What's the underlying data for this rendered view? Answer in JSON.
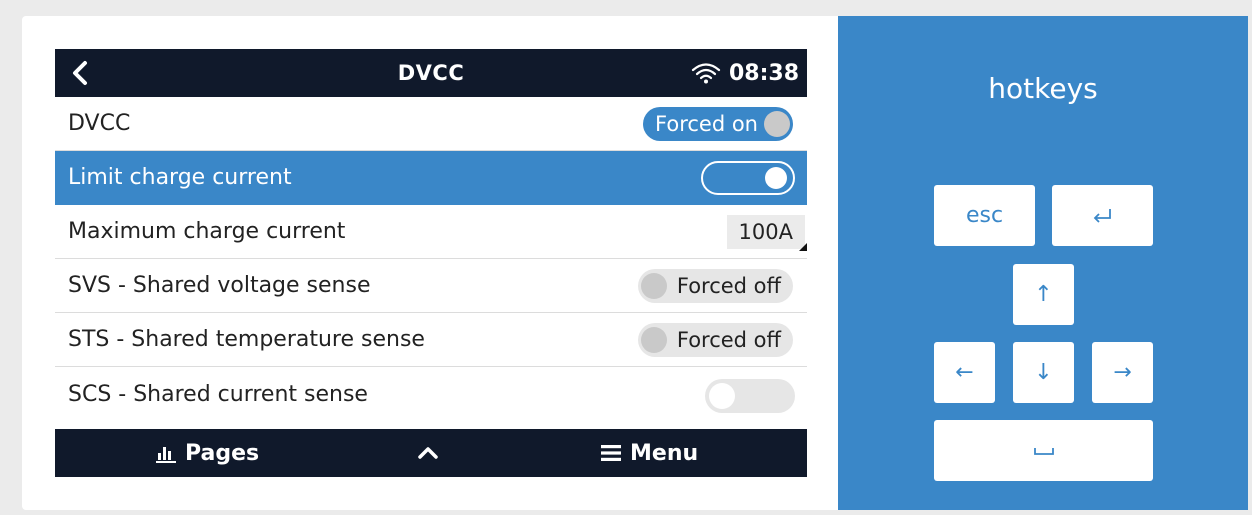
{
  "screen": {
    "title": "DVCC",
    "time": "08:38",
    "icons": {
      "back": "chevron-left-icon",
      "wifi": "wifi-icon"
    }
  },
  "settings": [
    {
      "label": "DVCC",
      "control": "pill-on",
      "value": "Forced on"
    },
    {
      "label": "Limit charge current",
      "control": "toggle",
      "state": "on",
      "selected": true
    },
    {
      "label": "Maximum charge current",
      "control": "value",
      "value": "100A"
    },
    {
      "label": "SVS - Shared voltage sense",
      "control": "pill-off",
      "value": "Forced off"
    },
    {
      "label": "STS - Shared temperature sense",
      "control": "pill-off",
      "value": "Forced off"
    },
    {
      "label": "SCS - Shared current sense",
      "control": "toggle",
      "state": "off"
    }
  ],
  "bottom_bar": {
    "pages_label": "Pages",
    "menu_label": "Menu",
    "icons": {
      "pages": "bar-chart-icon",
      "up": "chevron-up-icon",
      "menu": "hamburger-menu-icon"
    }
  },
  "hotkeys": {
    "title": "hotkeys",
    "keys": {
      "esc": "esc",
      "enter": "⏎",
      "up": "↑",
      "left": "←",
      "down": "↓",
      "right": "→",
      "space": "⎵"
    }
  },
  "colors": {
    "accent": "#3a87c8",
    "bar": "#10192b",
    "background": "#ebebeb"
  }
}
